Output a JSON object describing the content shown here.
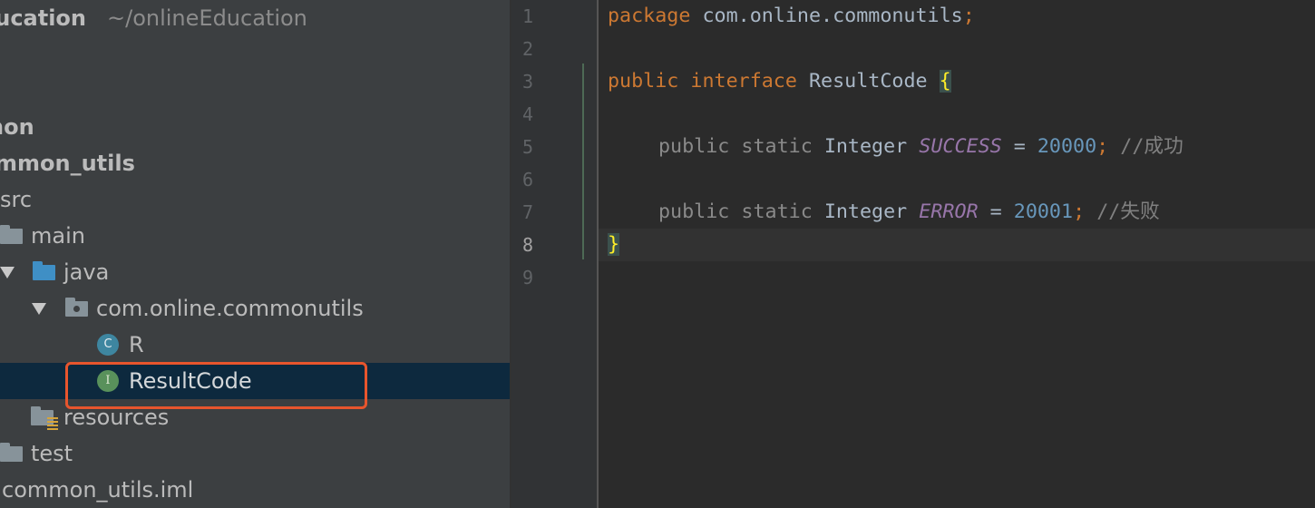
{
  "project_tree": {
    "root": {
      "name": "lucation",
      "path": "~/onlineEducation"
    },
    "items": [
      {
        "label": "non"
      },
      {
        "label": "mmon_utils"
      },
      {
        "label": "src"
      },
      {
        "label": "main"
      },
      {
        "label": "java"
      },
      {
        "label": "com.online.commonutils"
      },
      {
        "label": "R",
        "badge": "C"
      },
      {
        "label": "ResultCode",
        "badge": "I",
        "selected": true
      },
      {
        "label": "resources"
      },
      {
        "label": "test"
      },
      {
        "label": "common_utils.iml"
      }
    ]
  },
  "editor": {
    "line_numbers": [
      "1",
      "2",
      "3",
      "4",
      "5",
      "6",
      "7",
      "8",
      "9"
    ],
    "current_line": "8",
    "tokens": {
      "package_kw": "package",
      "package_name": "com.online.commonutils",
      "semicolon": ";",
      "public_kw": "public",
      "interface_kw": "interface",
      "type_name": "ResultCode",
      "open_brace": "{",
      "close_brace": "}",
      "field_public": "public",
      "field_static": "static",
      "field_type": "Integer",
      "equals": "=",
      "success_name": "SUCCESS",
      "success_value": "20000",
      "success_comment": "//成功",
      "error_name": "ERROR",
      "error_value": "20001",
      "error_comment": "//失败"
    }
  },
  "colors": {
    "tree_background": "#3c3f41",
    "selection": "#0d293e",
    "highlight_border": "#e8552d",
    "editor_background": "#2b2b2b",
    "keyword": "#cc7832",
    "number": "#6897bb",
    "field": "#9876aa",
    "brace_match": "#ffef28"
  }
}
